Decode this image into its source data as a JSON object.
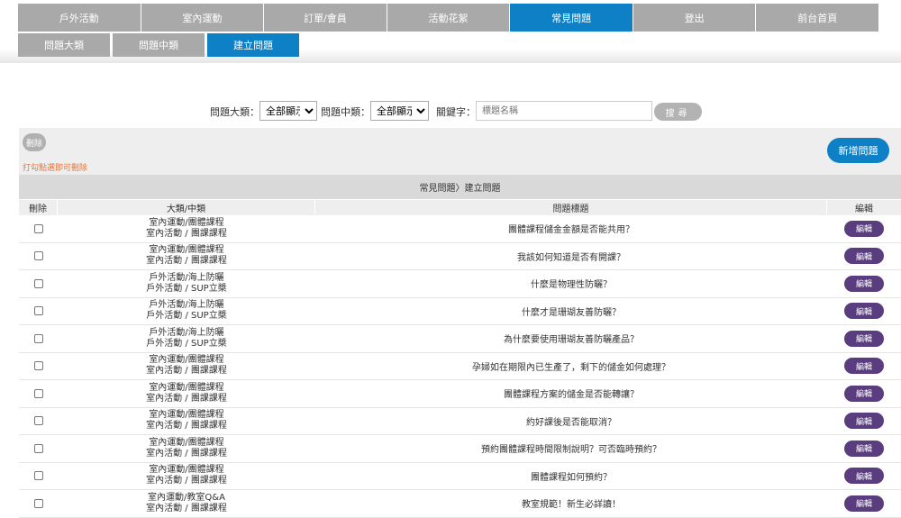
{
  "nav": [
    {
      "label": "戶外活動",
      "active": false
    },
    {
      "label": "室內運動",
      "active": false
    },
    {
      "label": "訂單/會員",
      "active": false
    },
    {
      "label": "活動花絮",
      "active": false
    },
    {
      "label": "常見問題",
      "active": true
    },
    {
      "label": "登出",
      "active": false
    },
    {
      "label": "前台首頁",
      "active": false
    }
  ],
  "subnav": [
    {
      "label": "問題大類",
      "active": false
    },
    {
      "label": "問題中類",
      "active": false
    },
    {
      "label": "建立問題",
      "active": true
    }
  ],
  "search": {
    "major_label": "問題大類：",
    "major_value": "全部顯示",
    "minor_label": "問題中類：",
    "minor_value": "全部顯示",
    "keyword_label": "關鍵字：",
    "keyword_placeholder": "標題名稱",
    "button_label": "搜尋"
  },
  "toolbar": {
    "delete_label": "刪除",
    "hint": "打勾點選即可刪除",
    "add_label": "新增問題"
  },
  "breadcrumb": "常見問題〉建立問題",
  "table": {
    "headers": {
      "delete": "刪除",
      "category": "大類/中類",
      "title": "問題標題",
      "edit": "編輯"
    },
    "edit_label": "編輯",
    "rows": [
      {
        "cat1": "室內運動/團體課程",
        "cat2": "室內活動 / 團課課程",
        "title": "團體課程儲金金額是否能共用？"
      },
      {
        "cat1": "室內運動/團體課程",
        "cat2": "室內活動 / 團課課程",
        "title": "我該如何知道是否有開課？"
      },
      {
        "cat1": "戶外活動/海上防曬",
        "cat2": "戶外活動 / SUP立槳",
        "title": "什麼是物理性防曬？"
      },
      {
        "cat1": "戶外活動/海上防曬",
        "cat2": "戶外活動 / SUP立槳",
        "title": "什麼才是珊瑚友善防曬？"
      },
      {
        "cat1": "戶外活動/海上防曬",
        "cat2": "戶外活動 / SUP立槳",
        "title": "為什麼要使用珊瑚友善防曬產品？"
      },
      {
        "cat1": "室內運動/團體課程",
        "cat2": "室內活動 / 團課課程",
        "title": "孕婦如在期限內已生產了，剩下的儲金如何處理？"
      },
      {
        "cat1": "室內運動/團體課程",
        "cat2": "室內活動 / 團課課程",
        "title": "團體課程方案的儲金是否能轉讓？"
      },
      {
        "cat1": "室內運動/團體課程",
        "cat2": "室內活動 / 團課課程",
        "title": "約好課後是否能取消？"
      },
      {
        "cat1": "室內運動/團體課程",
        "cat2": "室內活動 / 團課課程",
        "title": "預約團體課程時間限制說明？可否臨時預約？"
      },
      {
        "cat1": "室內運動/團體課程",
        "cat2": "室內活動 / 團課課程",
        "title": "團體課程如何預約？"
      },
      {
        "cat1": "室內運動/教室Q&A",
        "cat2": "室內活動 / 團課課程",
        "title": "教室規範！新生必詳讀！"
      }
    ]
  },
  "colors": {
    "accent": "#0e80c5",
    "nav_inactive": "#a9a9a9",
    "edit_button": "#5a3d7e",
    "hint": "#e8743b"
  }
}
